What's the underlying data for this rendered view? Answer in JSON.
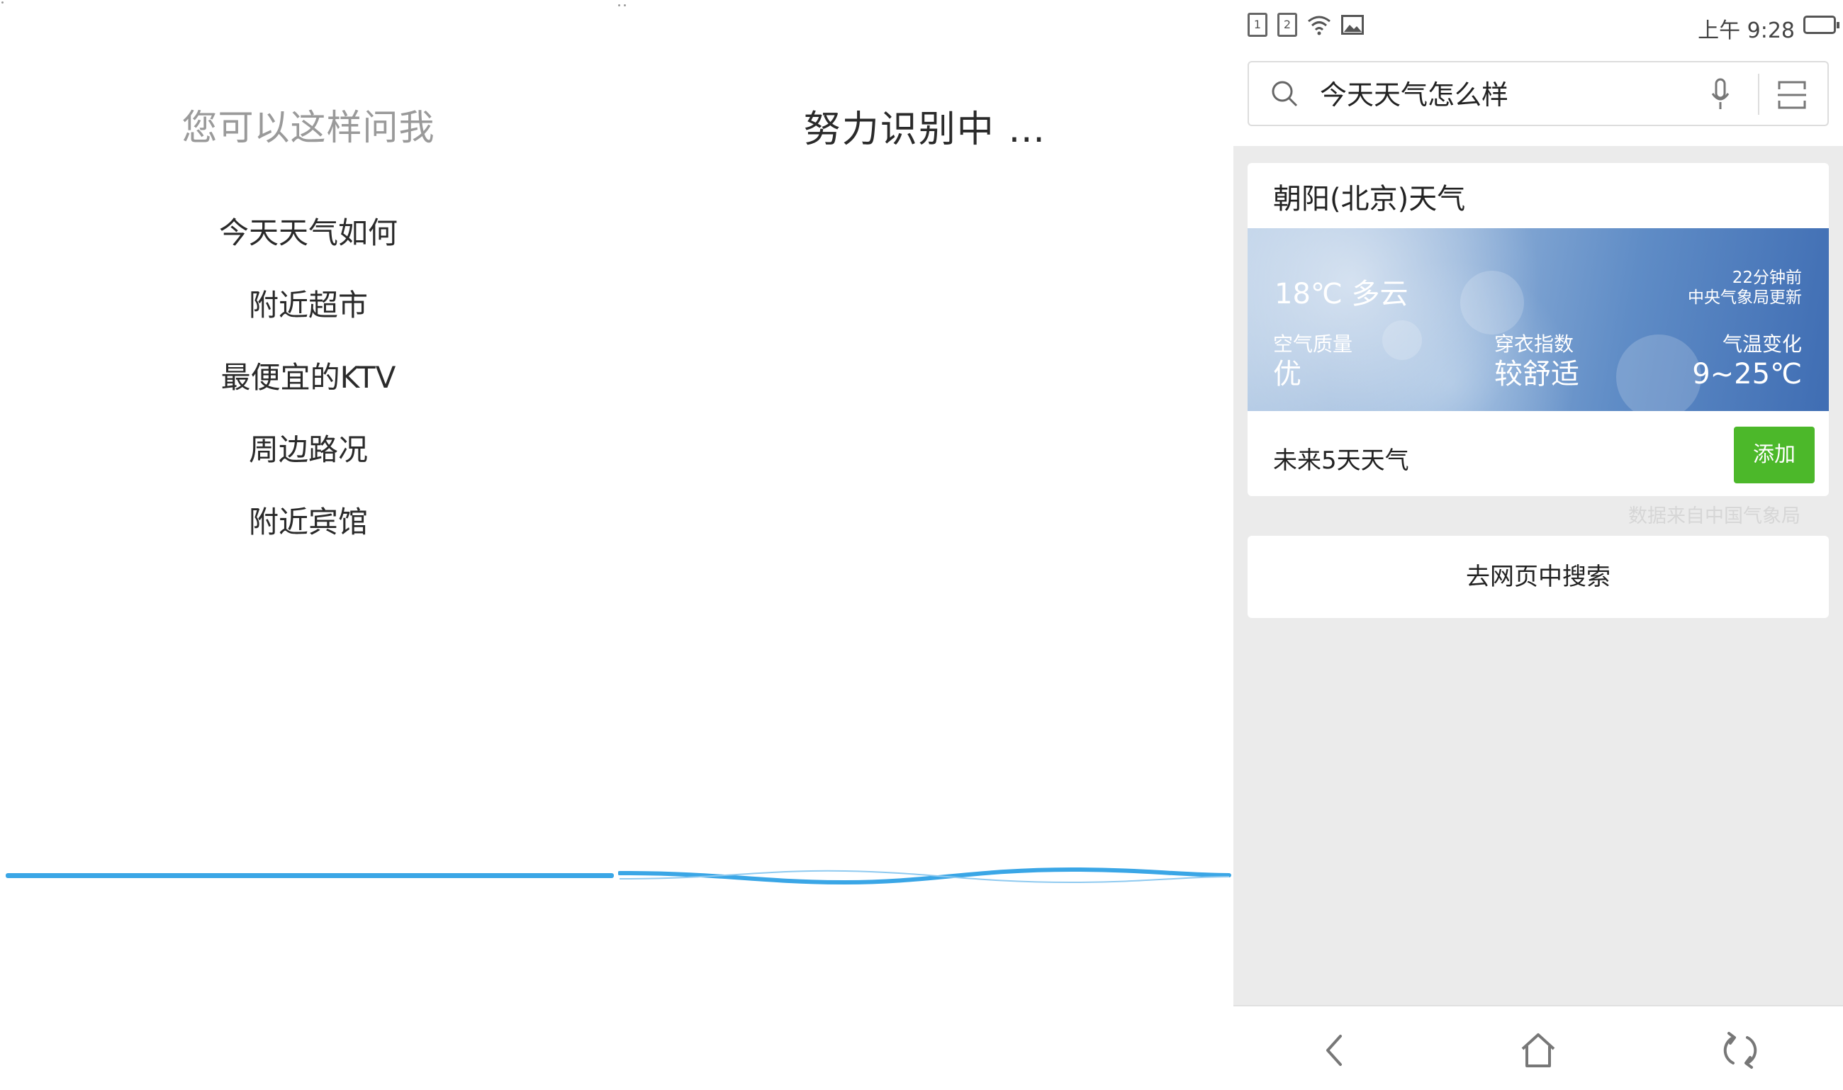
{
  "panel1": {
    "title": "您可以这样问我",
    "suggestions": [
      "今天天气如何",
      "附近超市",
      "最便宜的KTV",
      "周边路况",
      "附近宾馆"
    ]
  },
  "panel2": {
    "title": "努力识别中 …"
  },
  "panel3": {
    "status_bar": {
      "sim1": "1",
      "sim2": "2",
      "time": "上午 9:28",
      "icons": [
        "sim1-icon",
        "sim2-icon",
        "wifi-icon",
        "image-icon",
        "battery-icon"
      ]
    },
    "search": {
      "query": "今天天气怎么样",
      "icons": [
        "search-icon",
        "microphone-icon",
        "scan-icon"
      ]
    },
    "weather": {
      "city": "朝阳(北京)天气",
      "current": "18℃ 多云",
      "updated_time": "22分钟前",
      "updated_source": "中央气象局更新",
      "air_quality_label": "空气质量",
      "air_quality_value": "优",
      "dressing_label": "穿衣指数",
      "dressing_value": "较舒适",
      "temp_change_label": "气温变化",
      "temp_change_value": "9~25℃",
      "future_label": "未来5天天气",
      "add_button": "添加",
      "source": "数据来自中国气象局"
    },
    "web_search": "去网页中搜索",
    "nav": [
      "back-icon",
      "home-icon",
      "refresh-icon"
    ],
    "colors": {
      "accent_blue": "#3aa6e6",
      "add_green": "#4cb82a",
      "background_gray": "#ebebeb"
    }
  }
}
